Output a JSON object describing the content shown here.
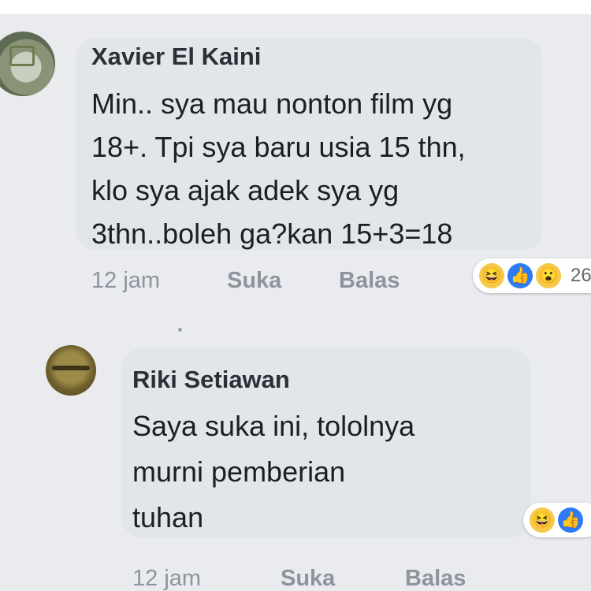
{
  "comments": [
    {
      "author": "Xavier El Kaini",
      "lines": [
        "Min.. sya mau nonton film yg",
        "18+. Tpi sya baru usia 15 thn,",
        "klo sya ajak adek sya yg",
        "3thn..boleh ga?kan 15+3=18"
      ],
      "time": "12 jam",
      "like_label": "Suka",
      "reply_label": "Balas",
      "reactions": [
        "haha-icon",
        "like-icon",
        "wow-icon"
      ],
      "reaction_count": "26"
    },
    {
      "author": "Riki Setiawan",
      "lines": [
        "Saya suka ini, tololnya",
        "murni pemberian",
        "tuhan"
      ],
      "time": "12 jam",
      "like_label": "Suka",
      "reply_label": "Balas",
      "reactions": [
        "haha-icon",
        "like-icon"
      ]
    }
  ],
  "colors": {
    "bubble": "#e2e5e9",
    "background": "#e9ebee",
    "like_blue": "#2e7bf6",
    "haha_yellow": "#f7c948"
  }
}
